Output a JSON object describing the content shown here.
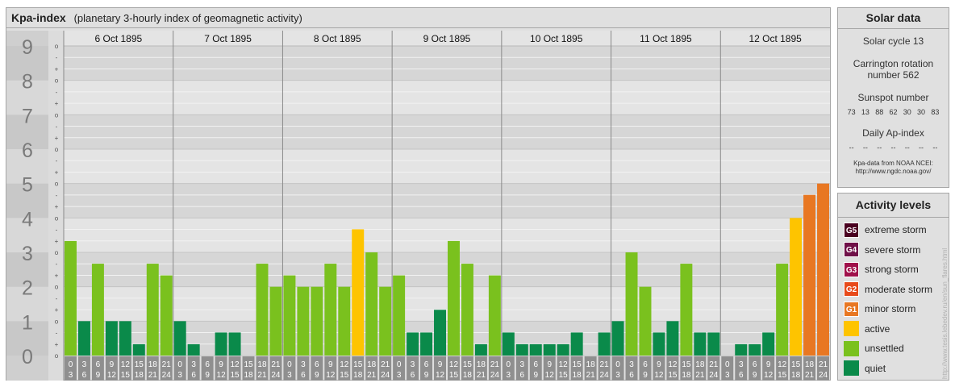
{
  "header": {
    "title": "Kpa-index",
    "subtitle": "(planetary 3-hourly index of geomagnetic activity)"
  },
  "chart_data": {
    "type": "bar",
    "title": "Kpa-index",
    "subtitle": "(planetary 3-hourly index of geomagnetic activity)",
    "ylim": [
      0,
      9
    ],
    "y_ticks": [
      "0",
      "1",
      "2",
      "3",
      "4",
      "5",
      "6",
      "7",
      "8",
      "9"
    ],
    "y_minor_ticks": [
      "o",
      "+",
      "-"
    ],
    "days": [
      "6 Oct 1895",
      "7 Oct 1895",
      "8 Oct 1895",
      "9 Oct 1895",
      "10 Oct 1895",
      "11 Oct 1895",
      "12 Oct 1895"
    ],
    "interval_top": [
      "0",
      "3",
      "6",
      "9",
      "12",
      "15",
      "18",
      "21"
    ],
    "interval_bottom": [
      "3",
      "6",
      "9",
      "12",
      "15",
      "18",
      "21",
      "24"
    ],
    "values": [
      [
        3.33,
        1.0,
        2.67,
        1.0,
        1.0,
        0.33,
        2.67,
        2.33
      ],
      [
        1.0,
        0.33,
        0.0,
        0.67,
        0.67,
        0.0,
        2.67,
        2.0
      ],
      [
        2.33,
        2.0,
        2.0,
        2.67,
        2.0,
        3.67,
        3.0,
        2.0
      ],
      [
        2.33,
        0.67,
        0.67,
        1.33,
        3.33,
        2.67,
        0.33,
        2.33
      ],
      [
        0.67,
        0.33,
        0.33,
        0.33,
        0.33,
        0.67,
        0.0,
        0.67
      ],
      [
        1.0,
        3.0,
        2.0,
        0.67,
        1.0,
        2.67,
        0.67,
        0.67
      ],
      [
        0.0,
        0.33,
        0.33,
        0.67,
        2.67,
        4.0,
        4.67,
        5.0
      ]
    ],
    "grid": true
  },
  "colors": {
    "quiet": "#0a8a4a",
    "unsettled": "#7ac11e",
    "active": "#fec400",
    "minor": "#e87722",
    "moderate": "#e84a1a",
    "strong": "#a0104a",
    "severe": "#701048",
    "extreme": "#4a0020"
  },
  "solar": {
    "title": "Solar data",
    "cycle": "Solar cycle 13",
    "carrington_1": "Carrington rotation",
    "carrington_2": "number 562",
    "sunspot_label": "Sunspot number",
    "sunspot_values": [
      "73",
      "13",
      "88",
      "62",
      "30",
      "30",
      "83"
    ],
    "ap_label": "Daily Ap-index",
    "ap_values": [
      "--",
      "--",
      "--",
      "--",
      "--",
      "--",
      "--"
    ],
    "note_1": "Kpa-data from NOAA NCEI:",
    "note_2": "http://www.ngdc.noaa.gov/"
  },
  "legend": {
    "title": "Activity levels",
    "items": [
      {
        "badge": "G5",
        "label": "extreme storm"
      },
      {
        "badge": "G4",
        "label": "severe storm"
      },
      {
        "badge": "G3",
        "label": "strong storm"
      },
      {
        "badge": "G2",
        "label": "moderate storm"
      },
      {
        "badge": "G1",
        "label": "minor storm"
      },
      {
        "badge": "",
        "label": "active"
      },
      {
        "badge": "",
        "label": "unsettled"
      },
      {
        "badge": "",
        "label": "quiet"
      }
    ]
  },
  "credit": "http://www.tesis.lebedev.ru/en/sun_flares.html"
}
